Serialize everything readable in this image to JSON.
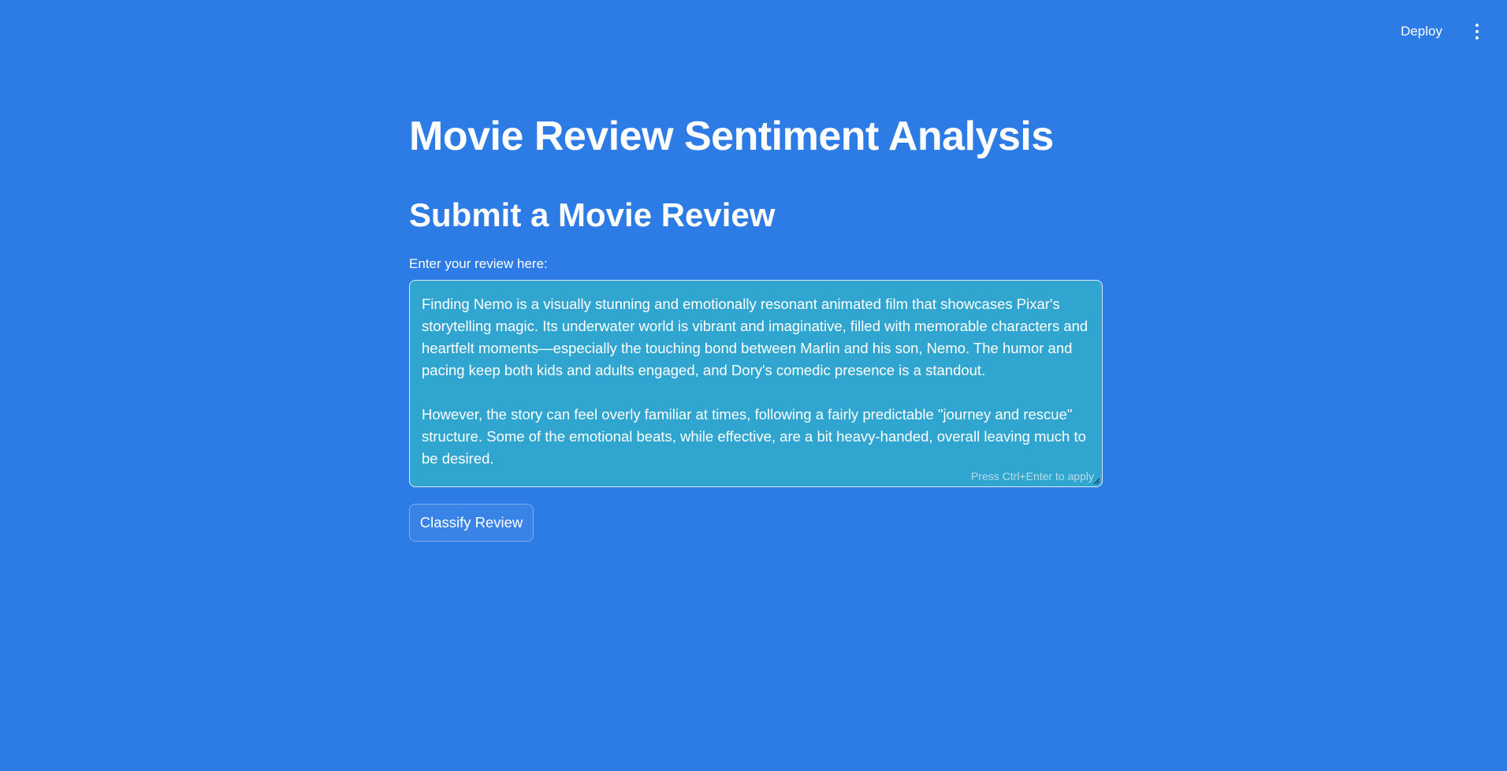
{
  "header": {
    "deploy_label": "Deploy",
    "menu_icon": "kebab-menu-icon"
  },
  "main": {
    "title": "Movie Review Sentiment Analysis",
    "subtitle": "Submit a Movie Review",
    "review_label": "Enter your review here:",
    "review_value": "Finding Nemo is a visually stunning and emotionally resonant animated film that showcases Pixar's storytelling magic. Its underwater world is vibrant and imaginative, filled with memorable characters and heartfelt moments—especially the touching bond between Marlin and his son, Nemo. The humor and pacing keep both kids and adults engaged, and Dory's comedic presence is a standout.\n\nHowever, the story can feel overly familiar at times, following a fairly predictable \"journey and rescue\" structure. Some of the emotional beats, while effective, are a bit heavy-handed, overall leaving much to be desired.",
    "review_hint": "Press Ctrl+Enter to apply",
    "classify_label": "Classify Review"
  },
  "colors": {
    "background": "#2d7be5",
    "textarea_background": "#2fa5cf",
    "text": "#ffffff"
  }
}
